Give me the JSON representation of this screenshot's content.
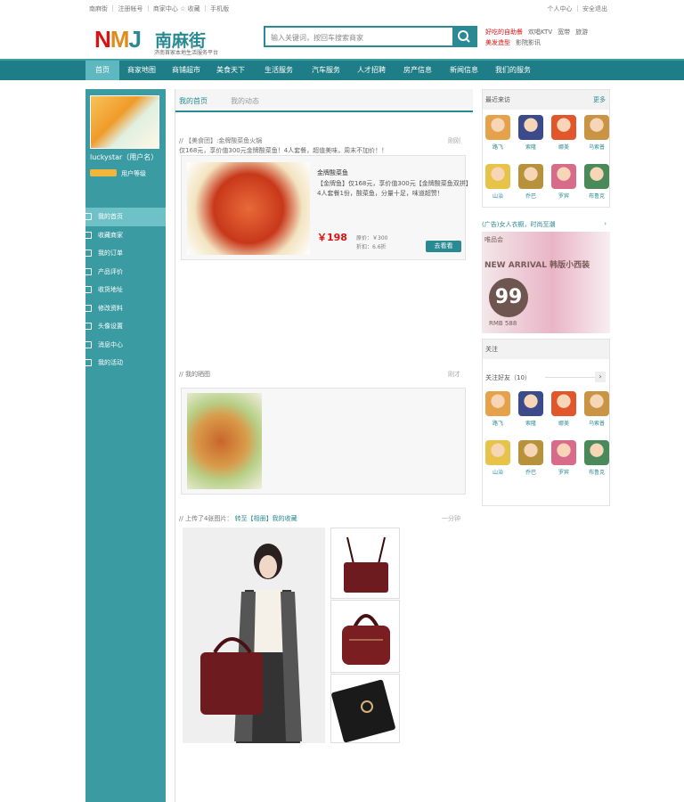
{
  "topbar": {
    "left": "南麻街 ｜ 注册帐号 ｜ 商家中心 ☆ 收藏 ｜ 手机版",
    "right": "个人中心 ｜ 安全退出"
  },
  "logo": {
    "nmj": "NMJ",
    "cn": "南麻街",
    "sub": "济南首家本地生活服务平台"
  },
  "search": {
    "placeholder": "输入关键词，按回车搜索商家"
  },
  "hot": {
    "items": [
      "好吃的自助餐",
      "欢唱KTV",
      "宽带",
      "旅游",
      "美发造型",
      "影院影讯"
    ]
  },
  "nav": {
    "items": [
      "首页",
      "商家地图",
      "商铺超市",
      "美食天下",
      "生活服务",
      "汽车服务",
      "人才招聘",
      "房产信息",
      "新闻信息",
      "我们的服务"
    ]
  },
  "side": {
    "username": "luckystar（用户名）",
    "badge": "用户等级",
    "menu": [
      "我的首页",
      "收藏商家",
      "我的订单",
      "产品评价",
      "收货地址",
      "修改资料",
      "头像设置",
      "消息中心",
      "我的活动"
    ]
  },
  "tabs": {
    "t1": "我的首页",
    "t2": "我的动态"
  },
  "post1": {
    "meta": "// 【美食团】:金牌酸菜鱼火锅",
    "desc": "仅168元，享价值300元金牌酸菜鱼！4人套餐，超值美味，周末不加价！！",
    "time": "刚刚",
    "shop": "金牌酸菜鱼",
    "detail1": "【金牌鱼】仅168元，享价值300元【金牌酸菜鱼双拼】",
    "detail2": "4人套餐1份，酸菜鱼，分量十足，味道超赞！",
    "price": "￥198",
    "orig": "原价：￥300",
    "discount": "折扣：6.6折",
    "btn": "去看看"
  },
  "post2": {
    "meta": "// 我的晒图",
    "time": "刚才"
  },
  "post3": {
    "meta": "// 上传了4张图片：",
    "link": "转至【相册】我的收藏",
    "time": "一分钟"
  },
  "right": {
    "visitors": {
      "title": "最近来访",
      "more": "更多"
    },
    "names1": [
      "路飞",
      "索隆",
      "娜美",
      "乌索普",
      "山治",
      "乔巴",
      "罗宾",
      "布鲁克"
    ],
    "adTitle": "(广告)女人衣橱，时尚至潮",
    "adBrand": "唯品会",
    "adHead": "NEW ARRIVAL 韩版小西装",
    "adNum": "99",
    "adPrice": "RMB 588",
    "follow": {
      "title": "关注"
    },
    "followCount": "关注好友（10）",
    "names2": [
      "路飞",
      "索隆",
      "娜美",
      "乌索普",
      "山治",
      "乔巴",
      "罗宾",
      "布鲁克"
    ]
  },
  "colors": {
    "brand": "#2a8a93",
    "accent": "#d11111",
    "nav": "#1e7d86"
  }
}
